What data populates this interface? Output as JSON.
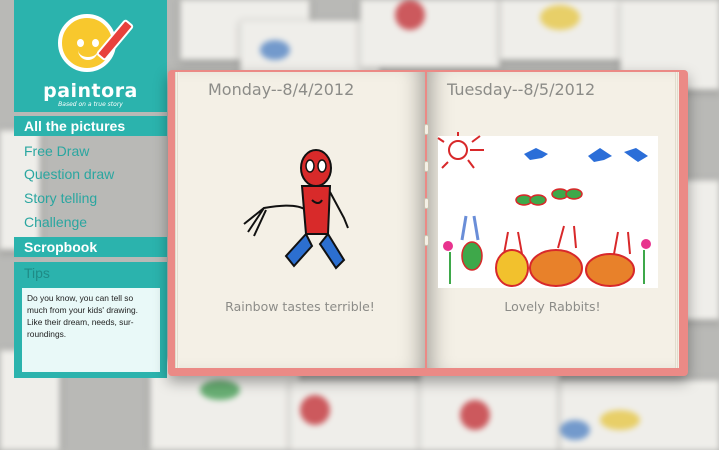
{
  "app": {
    "logo_text": "paintora",
    "tagline": "Based on a true story"
  },
  "nav": {
    "items": [
      {
        "label": "All the pictures",
        "active": true
      },
      {
        "label": "Free Draw",
        "active": false
      },
      {
        "label": "Question draw",
        "active": false
      },
      {
        "label": "Story telling",
        "active": false
      },
      {
        "label": "Challenge",
        "active": false
      },
      {
        "label": "Scropbook",
        "active": true
      }
    ]
  },
  "tips": {
    "title": "Tips",
    "body": "Do you know, you can tell so much from your kids' drawing. Like their dream, needs, sur-roundings."
  },
  "book": {
    "left_page": {
      "date": "Monday--8/4/2012",
      "caption": "Rainbow tastes terrible!",
      "drawing_icon": "spiderman-drawing"
    },
    "right_page": {
      "date": "Tuesday--8/5/2012",
      "caption": "Lovely Rabbits!",
      "drawing_icon": "rabbits-drawing"
    }
  },
  "colors": {
    "accent": "#2bb3ad",
    "book_cover": "#eb8a86",
    "page": "#f4f0e6"
  }
}
